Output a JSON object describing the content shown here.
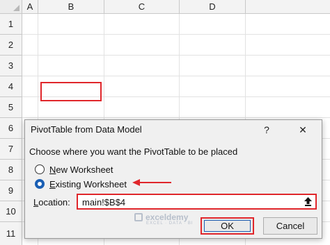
{
  "sheet": {
    "columns": [
      "A",
      "B",
      "C",
      "D"
    ],
    "rows": [
      "1",
      "2",
      "3",
      "4",
      "5",
      "6",
      "7",
      "8",
      "9",
      "10",
      "11"
    ],
    "highlight_color": "#e0262b"
  },
  "dialog": {
    "title": "PivotTable from Data Model",
    "help_glyph": "?",
    "close_glyph": "✕",
    "prompt": "Choose where you want the PivotTable to be placed",
    "options": {
      "new_prefix": "N",
      "new_rest": "ew Worksheet",
      "existing_prefix": "E",
      "existing_rest": "xisting Worksheet",
      "selected": "existing"
    },
    "location_prefix": "L",
    "location_rest": "ocation:",
    "location_value": "main!$B$4",
    "ok_label": "OK",
    "cancel_label": "Cancel",
    "accent_color": "#1a5fb4",
    "collapse_icon": "upload-arrow-icon"
  },
  "watermark": {
    "name": "exceldemy",
    "tagline": "EXCEL · DATA · BI"
  }
}
